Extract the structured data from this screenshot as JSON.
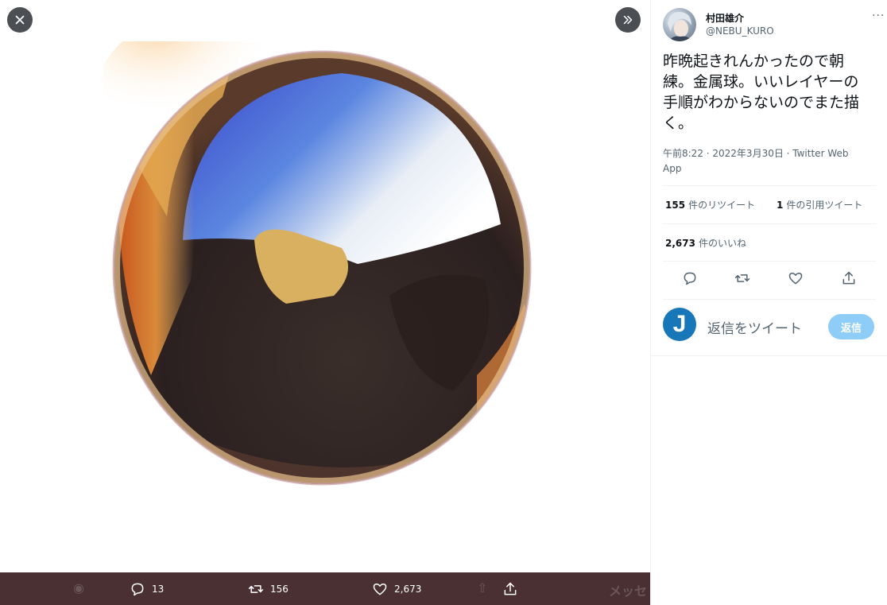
{
  "viewer": {
    "close_icon": "close-icon",
    "expand_icon": "double-chevron-right-icon",
    "image_alt": "metal sphere illustration"
  },
  "bottom_bar": {
    "reply_count": "13",
    "retweet_count": "156",
    "like_count": "2,673",
    "ghost_text": "メッセ"
  },
  "tweet": {
    "display_name": "村田雄介",
    "handle": "@NEBU_KURO",
    "more_label": "···",
    "text": "昨晩起きれんかったので朝練。金属球。いいレイヤーの手順がわからないのでまた描く。",
    "timestamp": "午前8:22 · 2022年3月30日 · Twitter Web App",
    "retweets": {
      "count": "155",
      "label": "件のリツイート"
    },
    "quotes": {
      "count": "1",
      "label": "件の引用ツイート"
    },
    "likes": {
      "count": "2,673",
      "label": "件のいいね"
    }
  },
  "reply": {
    "avatar_letter": "J",
    "placeholder": "返信をツイート",
    "button_label": "返信"
  },
  "colors": {
    "bottom_bar": "#4a3033",
    "reply_button": "#8ecdf8",
    "reply_avatar": "#1877b8"
  }
}
